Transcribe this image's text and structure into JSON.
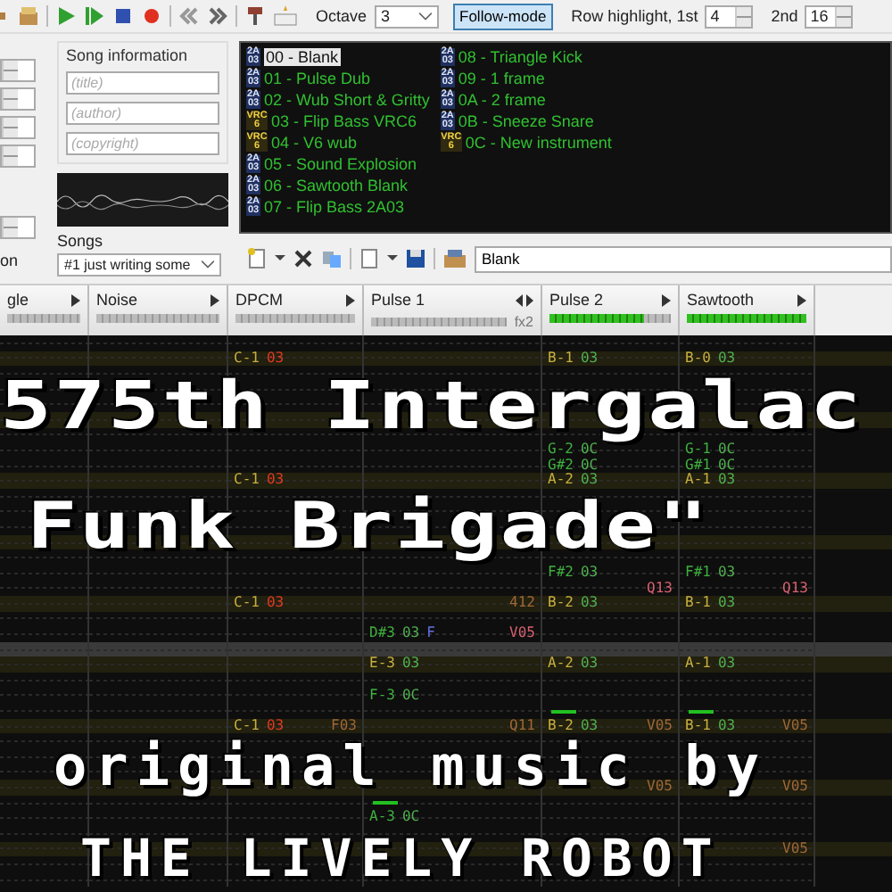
{
  "toolbar": {
    "octave_label": "Octave",
    "octave": "3",
    "follow_mode": {
      "label": "Follow-mode",
      "selected": true
    },
    "row_highlight_label": "Row highlight, 1st",
    "row_highlight_1st": "4",
    "second_label": "2nd",
    "row_highlight_2nd": "16"
  },
  "left_panel": {
    "trailing_label": "on"
  },
  "song_information": {
    "title": "Song information",
    "fields": [
      {
        "placeholder": "(title)"
      },
      {
        "placeholder": "(author)"
      },
      {
        "placeholder": "(copyright)"
      }
    ],
    "songs_label": "Songs",
    "song": "#1 just writing some"
  },
  "instruments": [
    {
      "chip": "2A03",
      "kind": "internal",
      "name": "00 - Blank",
      "selected": true
    },
    {
      "chip": "2A03",
      "kind": "internal",
      "name": "01 - Pulse Dub",
      "selected": false
    },
    {
      "chip": "2A03",
      "kind": "internal",
      "name": "02 - Wub Short & Gritty",
      "selected": false
    },
    {
      "chip": "VRC6",
      "kind": "expansion",
      "name": "03 - Flip Bass VRC6",
      "selected": false
    },
    {
      "chip": "VRC6",
      "kind": "expansion",
      "name": "04 - V6 wub",
      "selected": false
    },
    {
      "chip": "2A03",
      "kind": "internal",
      "name": "05 - Sound Explosion",
      "selected": false
    },
    {
      "chip": "2A03",
      "kind": "internal",
      "name": "06 - Sawtooth Blank",
      "selected": false
    },
    {
      "chip": "2A03",
      "kind": "internal",
      "name": "07 - Flip Bass 2A03",
      "selected": false
    },
    {
      "chip": "2A03",
      "kind": "internal",
      "name": "08 - Triangle Kick",
      "selected": false
    },
    {
      "chip": "2A03",
      "kind": "internal",
      "name": "09 - 1 frame",
      "selected": false
    },
    {
      "chip": "2A03",
      "kind": "internal",
      "name": "0A - 2 frame",
      "selected": false
    },
    {
      "chip": "2A03",
      "kind": "internal",
      "name": "0B - Sneeze Snare",
      "selected": false
    },
    {
      "chip": "VRC6",
      "kind": "expansion",
      "name": "0C - New instrument",
      "selected": false
    }
  ],
  "instrument_name": "Blank",
  "channels": [
    {
      "name": "gle",
      "level": 0
    },
    {
      "name": "Noise",
      "level": 0
    },
    {
      "name": "DPCM",
      "level": 0
    },
    {
      "name": "Pulse 1",
      "level": 0,
      "effect_columns": "fx2"
    },
    {
      "name": "Pulse 2",
      "level": 0.78
    },
    {
      "name": "Sawtooth",
      "level": 1
    }
  ],
  "rows": [
    {
      "highlighted": false,
      "selected": false
    },
    {
      "highlighted": true,
      "selected": false,
      "dpcm": {
        "note": "C-1",
        "instrument": "03",
        "instrument_missing": true
      },
      "pulse_2": {
        "note": "B-1",
        "instrument": "03"
      },
      "sawtooth": {
        "note": "B-0",
        "instrument": "03"
      }
    },
    {
      "highlighted": false,
      "selected": false
    },
    {
      "highlighted": false,
      "selected": false
    },
    {
      "highlighted": false,
      "selected": false
    },
    {
      "highlighted": true,
      "selected": false
    },
    {
      "highlighted": false,
      "selected": false
    },
    {
      "highlighted": false,
      "selected": false,
      "pulse_2": {
        "note": "G-2",
        "instrument": "0C"
      },
      "sawtooth": {
        "note": "G-1",
        "instrument": "0C"
      }
    },
    {
      "highlighted": false,
      "selected": false,
      "pulse_2": {
        "note": "G#2",
        "instrument": "0C"
      },
      "sawtooth": {
        "note": "G#1",
        "instrument": "0C"
      }
    },
    {
      "highlighted": true,
      "selected": false,
      "dpcm": {
        "note": "C-1",
        "instrument": "03",
        "instrument_missing": true
      },
      "pulse_2": {
        "note": "A-2",
        "instrument": "03"
      },
      "sawtooth": {
        "note": "A-1",
        "instrument": "03"
      }
    },
    {
      "highlighted": false,
      "selected": false
    },
    {
      "highlighted": false,
      "selected": false
    },
    {
      "highlighted": false,
      "selected": false
    },
    {
      "highlighted": true,
      "selected": false
    },
    {
      "highlighted": false,
      "selected": false
    },
    {
      "highlighted": false,
      "selected": false,
      "pulse_2": {
        "note": "F#2",
        "instrument": "03"
      },
      "sawtooth": {
        "note": "F#1",
        "instrument": "03"
      }
    },
    {
      "highlighted": false,
      "selected": false,
      "pulse_2": {
        "effect": "Q13"
      },
      "sawtooth": {
        "effect": "Q13"
      }
    },
    {
      "highlighted": true,
      "selected": false,
      "dpcm": {
        "note": "C-1",
        "instrument": "03",
        "instrument_missing": true
      },
      "pulse_1": {
        "effect": "412"
      },
      "pulse_2": {
        "note": "B-2",
        "instrument": "03"
      },
      "sawtooth": {
        "note": "B-1",
        "instrument": "03"
      }
    },
    {
      "highlighted": false,
      "selected": false
    },
    {
      "highlighted": false,
      "selected": false,
      "pulse_1": {
        "note": "D#3",
        "instrument": "03",
        "volume": "F",
        "effect": "V05"
      }
    },
    {
      "highlighted": false,
      "selected": true
    },
    {
      "highlighted": true,
      "selected": false,
      "pulse_1": {
        "note": "E-3",
        "instrument": "03"
      },
      "pulse_2": {
        "note": "A-2",
        "instrument": "03"
      },
      "sawtooth": {
        "note": "A-1",
        "instrument": "03"
      }
    },
    {
      "highlighted": false,
      "selected": false
    },
    {
      "highlighted": false,
      "selected": false,
      "pulse_1": {
        "note": "F-3",
        "instrument": "0C"
      }
    },
    {
      "highlighted": false,
      "selected": false,
      "pulse_2": {
        "cut": true
      },
      "sawtooth": {
        "cut": true
      }
    },
    {
      "highlighted": true,
      "selected": false,
      "dpcm": {
        "note": "C-1",
        "instrument": "03",
        "instrument_missing": true,
        "effect": "F03"
      },
      "pulse_1": {
        "effect": "Q11"
      },
      "pulse_2": {
        "note": "B-2",
        "instrument": "03",
        "effect": "V05"
      },
      "sawtooth": {
        "note": "B-1",
        "instrument": "03",
        "effect": "V05"
      }
    },
    {
      "highlighted": false,
      "selected": false
    },
    {
      "highlighted": false,
      "selected": false
    },
    {
      "highlighted": false,
      "selected": false
    },
    {
      "highlighted": true,
      "selected": false,
      "pulse_2": {
        "effect": "V05"
      },
      "sawtooth": {
        "effect": "V05"
      }
    },
    {
      "highlighted": false,
      "selected": false,
      "pulse_1": {
        "cut": true
      }
    },
    {
      "highlighted": false,
      "selected": false,
      "pulse_1": {
        "note": "A-3",
        "instrument": "0C"
      }
    },
    {
      "highlighted": false,
      "selected": false
    },
    {
      "highlighted": true,
      "selected": false,
      "sawtooth": {
        "effect": "V05"
      }
    },
    {
      "highlighted": false,
      "selected": false
    },
    {
      "highlighted": false,
      "selected": false
    }
  ],
  "overlay_title": [
    "575th Intergalac",
    "Funk Brigade\""
  ],
  "overlay_credit_words": [
    "original",
    "music",
    "by"
  ],
  "overlay_credit_name": "THE LIVELY ROBOT"
}
